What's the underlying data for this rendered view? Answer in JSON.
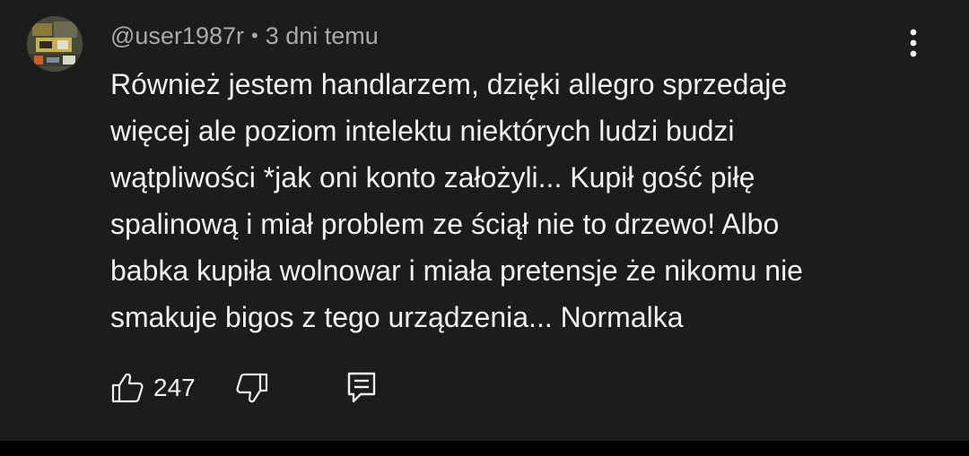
{
  "comment": {
    "author": "@user1987r",
    "separator": "•",
    "timestamp": "3 dni temu",
    "text": "Również jestem handlarzem, dzięki allegro sprzedaje\nwięcej ale poziom intelektu niektórych ludzi budzi\nwątpliwości *jak oni konto założyli... Kupił gość piłę\nspalinową i miał problem ze ściął nie to drzewo! Albo\nbabka kupiła wolnowar i miała pretensje że nikomu nie\nsmakuje bigos z tego urządzenia... Normalka",
    "like_count": "247"
  },
  "icons": {
    "more": "more-vert-icon",
    "like": "thumb-up-icon",
    "dislike": "thumb-down-icon",
    "reply": "reply-comment-icon"
  },
  "colors": {
    "background": "#1c1c1c",
    "text_primary": "#f1f1f1",
    "text_secondary": "#aaaaaa"
  }
}
